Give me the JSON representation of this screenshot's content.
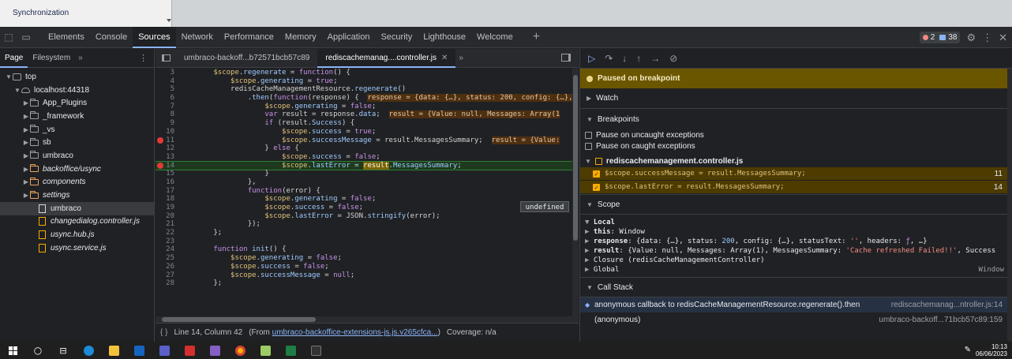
{
  "top_strip": {
    "label": "Synchronization"
  },
  "devtools_tabs": [
    {
      "label": "Elements",
      "active": false
    },
    {
      "label": "Console",
      "active": false
    },
    {
      "label": "Sources",
      "active": true
    },
    {
      "label": "Network",
      "active": false
    },
    {
      "label": "Performance",
      "active": false
    },
    {
      "label": "Memory",
      "active": false
    },
    {
      "label": "Application",
      "active": false
    },
    {
      "label": "Security",
      "active": false
    },
    {
      "label": "Lighthouse",
      "active": false
    },
    {
      "label": "Welcome",
      "active": false
    }
  ],
  "badges": {
    "errors": "2",
    "messages": "38"
  },
  "navigator": {
    "tabs": [
      "Page",
      "Filesystem"
    ],
    "more": "»",
    "tree": [
      {
        "indent": 0,
        "twisty": "▼",
        "icon": "frame",
        "label": "top",
        "italic": false,
        "selected": false
      },
      {
        "indent": 1,
        "twisty": "▼",
        "icon": "cloud",
        "label": "localhost:44318",
        "italic": false,
        "selected": false
      },
      {
        "indent": 2,
        "twisty": "▶",
        "icon": "folder",
        "label": "App_Plugins",
        "italic": false,
        "selected": false
      },
      {
        "indent": 2,
        "twisty": "▶",
        "icon": "folder",
        "label": "_framework",
        "italic": false,
        "selected": false
      },
      {
        "indent": 2,
        "twisty": "▶",
        "icon": "folder",
        "label": "_vs",
        "italic": false,
        "selected": false
      },
      {
        "indent": 2,
        "twisty": "▶",
        "icon": "folder",
        "label": "sb",
        "italic": false,
        "selected": false
      },
      {
        "indent": 2,
        "twisty": "▶",
        "icon": "folder",
        "label": "umbraco",
        "italic": false,
        "selected": false
      },
      {
        "indent": 2,
        "twisty": "▶",
        "icon": "folder-orange",
        "label": "backoffice/usync",
        "italic": true,
        "selected": false
      },
      {
        "indent": 2,
        "twisty": "▶",
        "icon": "folder-orange",
        "label": "components",
        "italic": true,
        "selected": false
      },
      {
        "indent": 2,
        "twisty": "▶",
        "icon": "folder-orange",
        "label": "settings",
        "italic": true,
        "selected": false
      },
      {
        "indent": 3,
        "twisty": "",
        "icon": "file",
        "label": "umbraco",
        "italic": false,
        "selected": true
      },
      {
        "indent": 3,
        "twisty": "",
        "icon": "file-js",
        "label": "changedialog.controller.js",
        "italic": true,
        "selected": false
      },
      {
        "indent": 3,
        "twisty": "",
        "icon": "file-js",
        "label": "usync.hub.js",
        "italic": true,
        "selected": false
      },
      {
        "indent": 3,
        "twisty": "",
        "icon": "file-js",
        "label": "usync.service.js",
        "italic": true,
        "selected": false
      }
    ]
  },
  "editor": {
    "tabs": [
      {
        "label": "umbraco-backoff...b72571bcb57c89",
        "active": false
      },
      {
        "label": "rediscachemanag....controller.js",
        "active": true
      }
    ],
    "more": "»",
    "tooltip": "undefined",
    "status": {
      "position": "Line 14, Column 42",
      "from_prefix": "(From",
      "from_link": "umbraco-backoffice-extensions-js.js.v265cfca...",
      "from_suffix": ")",
      "coverage": "Coverage: n/a"
    },
    "lines": [
      {
        "n": "3",
        "bp": false,
        "hl": false,
        "segs": [
          [
            "p",
            "        "
          ],
          [
            "v",
            "$scope"
          ],
          [
            "p",
            "."
          ],
          [
            "ph",
            "regenerate"
          ],
          [
            "p",
            " = "
          ],
          [
            "kw",
            "function"
          ],
          [
            "p",
            "() {"
          ]
        ]
      },
      {
        "n": "4",
        "bp": false,
        "hl": false,
        "segs": [
          [
            "p",
            "            "
          ],
          [
            "v",
            "$scope"
          ],
          [
            "p",
            "."
          ],
          [
            "ph",
            "generating"
          ],
          [
            "p",
            " = "
          ],
          [
            "kw",
            "true"
          ],
          [
            "p",
            ";"
          ]
        ]
      },
      {
        "n": "5",
        "bp": false,
        "hl": false,
        "segs": [
          [
            "p",
            "            redisCacheManagementResource."
          ],
          [
            "ph",
            "regenerate"
          ],
          [
            "p",
            "()"
          ]
        ]
      },
      {
        "n": "6",
        "bp": false,
        "hl": false,
        "segs": [
          [
            "p",
            "                ."
          ],
          [
            "ph",
            "then"
          ],
          [
            "p",
            "("
          ],
          [
            "kw",
            "function"
          ],
          [
            "p",
            "(response) {  "
          ],
          [
            "inl",
            "response = {data: {…}, status: 200, config: {…},"
          ]
        ]
      },
      {
        "n": "7",
        "bp": false,
        "hl": false,
        "segs": [
          [
            "p",
            "                    "
          ],
          [
            "v",
            "$scope"
          ],
          [
            "p",
            "."
          ],
          [
            "ph",
            "generating"
          ],
          [
            "p",
            " = "
          ],
          [
            "kw",
            "false"
          ],
          [
            "p",
            ";"
          ]
        ]
      },
      {
        "n": "8",
        "bp": false,
        "hl": false,
        "segs": [
          [
            "p",
            "                    "
          ],
          [
            "kw",
            "var"
          ],
          [
            "p",
            " result = response."
          ],
          [
            "ph",
            "data"
          ],
          [
            "p",
            ";  "
          ],
          [
            "inl",
            "result = {Value: null, Messages: Array(1"
          ]
        ]
      },
      {
        "n": "9",
        "bp": false,
        "hl": false,
        "segs": [
          [
            "p",
            "                    "
          ],
          [
            "kw",
            "if"
          ],
          [
            "p",
            " (result."
          ],
          [
            "ph",
            "Success"
          ],
          [
            "p",
            ") {"
          ]
        ]
      },
      {
        "n": "10",
        "bp": false,
        "hl": false,
        "segs": [
          [
            "p",
            "                        "
          ],
          [
            "v",
            "$scope"
          ],
          [
            "p",
            "."
          ],
          [
            "ph",
            "success"
          ],
          [
            "p",
            " = "
          ],
          [
            "kw",
            "true"
          ],
          [
            "p",
            ";"
          ]
        ]
      },
      {
        "n": "11",
        "bp": true,
        "hl": false,
        "segs": [
          [
            "p",
            "                        "
          ],
          [
            "v",
            "$scope"
          ],
          [
            "p",
            "."
          ],
          [
            "ph",
            "successMessage"
          ],
          [
            "p",
            " = result.MessagesSummary;  "
          ],
          [
            "inl",
            "result = {Value:"
          ]
        ]
      },
      {
        "n": "12",
        "bp": false,
        "hl": false,
        "segs": [
          [
            "p",
            "                    } "
          ],
          [
            "kw",
            "else"
          ],
          [
            "p",
            " {"
          ]
        ]
      },
      {
        "n": "13",
        "bp": false,
        "hl": false,
        "segs": [
          [
            "p",
            "                        "
          ],
          [
            "v",
            "$scope"
          ],
          [
            "p",
            "."
          ],
          [
            "ph",
            "success"
          ],
          [
            "p",
            " = "
          ],
          [
            "kw",
            "false"
          ],
          [
            "p",
            ";"
          ]
        ]
      },
      {
        "n": "14",
        "bp": true,
        "hl": true,
        "segs": [
          [
            "p",
            "                        "
          ],
          [
            "v",
            "$scope"
          ],
          [
            "p",
            "."
          ],
          [
            "ph",
            "lastError"
          ],
          [
            "p",
            " = "
          ],
          [
            "exec",
            "result"
          ],
          [
            "p",
            "."
          ],
          [
            "ph",
            "MessagesSummary"
          ],
          [
            "p",
            ";"
          ]
        ]
      },
      {
        "n": "15",
        "bp": false,
        "hl": false,
        "segs": [
          [
            "p",
            "                    }"
          ]
        ]
      },
      {
        "n": "16",
        "bp": false,
        "hl": false,
        "segs": [
          [
            "p",
            "                },"
          ]
        ]
      },
      {
        "n": "17",
        "bp": false,
        "hl": false,
        "segs": [
          [
            "p",
            "                "
          ],
          [
            "kw",
            "function"
          ],
          [
            "p",
            "(error) {"
          ]
        ]
      },
      {
        "n": "18",
        "bp": false,
        "hl": false,
        "segs": [
          [
            "p",
            "                    "
          ],
          [
            "v",
            "$scope"
          ],
          [
            "p",
            "."
          ],
          [
            "ph",
            "generating"
          ],
          [
            "p",
            " = "
          ],
          [
            "kw",
            "false"
          ],
          [
            "p",
            ";"
          ]
        ]
      },
      {
        "n": "19",
        "bp": false,
        "hl": false,
        "segs": [
          [
            "p",
            "                    "
          ],
          [
            "v",
            "$scope"
          ],
          [
            "p",
            "."
          ],
          [
            "ph",
            "success"
          ],
          [
            "p",
            " = "
          ],
          [
            "kw",
            "false"
          ],
          [
            "p",
            ";"
          ]
        ]
      },
      {
        "n": "20",
        "bp": false,
        "hl": false,
        "segs": [
          [
            "p",
            "                    "
          ],
          [
            "v",
            "$scope"
          ],
          [
            "p",
            "."
          ],
          [
            "ph",
            "lastError"
          ],
          [
            "p",
            " = JSON."
          ],
          [
            "ph",
            "stringify"
          ],
          [
            "p",
            "(error);"
          ]
        ]
      },
      {
        "n": "21",
        "bp": false,
        "hl": false,
        "segs": [
          [
            "p",
            "                });"
          ]
        ]
      },
      {
        "n": "22",
        "bp": false,
        "hl": false,
        "segs": [
          [
            "p",
            "        };"
          ]
        ]
      },
      {
        "n": "23",
        "bp": false,
        "hl": false,
        "segs": [
          [
            "p",
            ""
          ]
        ]
      },
      {
        "n": "24",
        "bp": false,
        "hl": false,
        "segs": [
          [
            "p",
            "        "
          ],
          [
            "kw",
            "function"
          ],
          [
            "p",
            " "
          ],
          [
            "ph",
            "init"
          ],
          [
            "p",
            "() {"
          ]
        ]
      },
      {
        "n": "25",
        "bp": false,
        "hl": false,
        "segs": [
          [
            "p",
            "            "
          ],
          [
            "v",
            "$scope"
          ],
          [
            "p",
            "."
          ],
          [
            "ph",
            "generating"
          ],
          [
            "p",
            " = "
          ],
          [
            "kw",
            "false"
          ],
          [
            "p",
            ";"
          ]
        ]
      },
      {
        "n": "26",
        "bp": false,
        "hl": false,
        "segs": [
          [
            "p",
            "            "
          ],
          [
            "v",
            "$scope"
          ],
          [
            "p",
            "."
          ],
          [
            "ph",
            "success"
          ],
          [
            "p",
            " = "
          ],
          [
            "kw",
            "false"
          ],
          [
            "p",
            ";"
          ]
        ]
      },
      {
        "n": "27",
        "bp": false,
        "hl": false,
        "segs": [
          [
            "p",
            "            "
          ],
          [
            "v",
            "$scope"
          ],
          [
            "p",
            "."
          ],
          [
            "ph",
            "successMessage"
          ],
          [
            "p",
            " = "
          ],
          [
            "kw",
            "null"
          ],
          [
            "p",
            ";"
          ]
        ]
      },
      {
        "n": "28",
        "bp": false,
        "hl": false,
        "segs": [
          [
            "p",
            "        };"
          ]
        ]
      }
    ]
  },
  "debugger": {
    "paused": "Paused on breakpoint",
    "watch": "Watch",
    "breakpoints": "Breakpoints",
    "pause_uncaught": "Pause on uncaught exceptions",
    "pause_caught": "Pause on caught exceptions",
    "bp_file": "rediscachemanagement.controller.js",
    "bp_items": [
      {
        "code": "$scope.successMessage = result.MessagesSummary;",
        "line": "11"
      },
      {
        "code": "$scope.lastError = result.MessagesSummary;",
        "line": "14"
      }
    ],
    "scope": "Scope",
    "scope_rows": [
      {
        "segs": [
          [
            "sg",
            "▼ "
          ],
          [
            "sk",
            "Local"
          ]
        ]
      },
      {
        "segs": [
          [
            "sg",
            "  ▶ "
          ],
          [
            "sk",
            "this"
          ],
          [
            "p",
            ": Window"
          ]
        ]
      },
      {
        "segs": [
          [
            "sg",
            "  ▶ "
          ],
          [
            "sk",
            "response"
          ],
          [
            "p",
            ": {data: {…}, status: "
          ],
          [
            "num",
            "200"
          ],
          [
            "p",
            ", config: {…}, statusText: "
          ],
          [
            "str",
            "''"
          ],
          [
            "p",
            ", headers: "
          ],
          [
            "kw",
            "ƒ"
          ],
          [
            "p",
            ", …}"
          ]
        ]
      },
      {
        "segs": [
          [
            "sg",
            "  ▶ "
          ],
          [
            "sk",
            "result"
          ],
          [
            "p",
            ": {Value: null, Messages: Array(1), MessagesSummary: "
          ],
          [
            "str",
            "'Cache refreshed Failed!!'"
          ],
          [
            "p",
            ", Success"
          ]
        ]
      },
      {
        "segs": [
          [
            "sg",
            "▶ "
          ],
          [
            "p",
            "Closure (redisCacheManagementController)"
          ]
        ]
      },
      {
        "segs": [
          [
            "sg",
            "▶ "
          ],
          [
            "p",
            "Global"
          ]
        ],
        "right": "Window"
      }
    ],
    "call_stack": "Call Stack",
    "frames": [
      {
        "name": "anonymous callback to redisCacheManagementResource.regenerate().then",
        "loc": "rediscachemanag...ntroller.js:14",
        "current": true
      },
      {
        "name": "(anonymous)",
        "loc": "umbraco-backoff...71bcb57c89:159",
        "current": false
      }
    ]
  },
  "taskbar": {
    "time": "10:13",
    "date": "06/06/2023"
  }
}
